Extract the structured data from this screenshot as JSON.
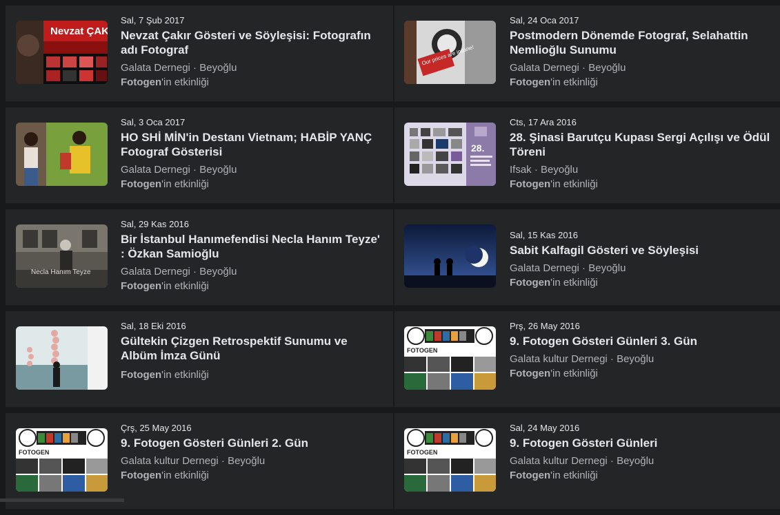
{
  "events": [
    {
      "date": "Sal, 7 Şub 2017",
      "title": "Nevzat Çakır Gösteri ve Söyleşisi: Fotografın adı Fotograf",
      "place": "Galata Dernegi · Beyoğlu",
      "host": "Fotogen",
      "host_suffix": "'in etkinliği",
      "thumb": "nevzat",
      "thumb_text": "Nevzat ÇAK"
    },
    {
      "date": "Sal, 24 Oca 2017",
      "title": "Postmodern Dönemde Fotograf, Selahattin Nemlioğlu Sunumu",
      "place": "Galata Dernegi · Beyoğlu",
      "host": "Fotogen",
      "host_suffix": "'in etkinliği",
      "thumb": "postmodern",
      "thumb_text": "Our prices are insane!"
    },
    {
      "date": "Sal, 3 Oca 2017",
      "title": "HO SHİ MİN'in Destanı Vietnam; HABİP YANÇ Fotograf Gösterisi",
      "place": "Galata Dernegi · Beyoğlu",
      "host": "Fotogen",
      "host_suffix": "'in etkinliği",
      "thumb": "vietnam"
    },
    {
      "date": "Cts, 17 Ara 2016",
      "title": "28. Şinasi Barutçu Kupası Sergi Açılışı ve Ödül Töreni",
      "place": "Ifsak · Beyoğlu",
      "host": "Fotogen",
      "host_suffix": "'in etkinliği",
      "thumb": "sinasi",
      "thumb_text": "28."
    },
    {
      "date": "Sal, 29 Kas 2016",
      "title": "Bir İstanbul Hanımefendisi Necla Hanım Teyze' : Özkan Samioğlu",
      "place": "Galata Dernegi · Beyoğlu",
      "host": "Fotogen",
      "host_suffix": "'in etkinliği",
      "thumb": "necla",
      "thumb_text": "Necla Hanım Teyze"
    },
    {
      "date": "Sal, 15 Kas 2016",
      "title": "Sabit Kalfagil Gösteri ve Söyleşisi",
      "place": "Galata Dernegi · Beyoğlu",
      "host": "Fotogen",
      "host_suffix": "'in etkinliği",
      "thumb": "moon"
    },
    {
      "date": "Sal, 18 Eki 2016",
      "title": "Gültekin Çizgen Retrospektif Sunumu ve Albüm İmza Günü",
      "place": "",
      "host": "Fotogen",
      "host_suffix": "'in etkinliği",
      "thumb": "gultekin"
    },
    {
      "date": "Prş, 26 May 2016",
      "title": "9. Fotogen Gösteri Günleri 3. Gün",
      "place": "Galata kultur Dernegi · Beyoğlu",
      "host": "Fotogen",
      "host_suffix": "'in etkinliği",
      "thumb": "fotogen",
      "thumb_text": "FOTOGEN"
    },
    {
      "date": "Çrş, 25 May 2016",
      "title": "9. Fotogen Gösteri Günleri 2. Gün",
      "place": "Galata kultur Dernegi · Beyoğlu",
      "host": "Fotogen",
      "host_suffix": "'in etkinliği",
      "thumb": "fotogen",
      "thumb_text": "FOTOGEN"
    },
    {
      "date": "Sal, 24 May 2016",
      "title": "9. Fotogen Gösteri Günleri",
      "place": "Galata kultur Dernegi · Beyoğlu",
      "host": "Fotogen",
      "host_suffix": "'in etkinliği",
      "thumb": "fotogen",
      "thumb_text": "FOTOGEN"
    }
  ],
  "colors": {
    "background": "#18191a",
    "card": "#242526",
    "primary_text": "#e4e6eb",
    "secondary_text": "#b0b3b8"
  }
}
